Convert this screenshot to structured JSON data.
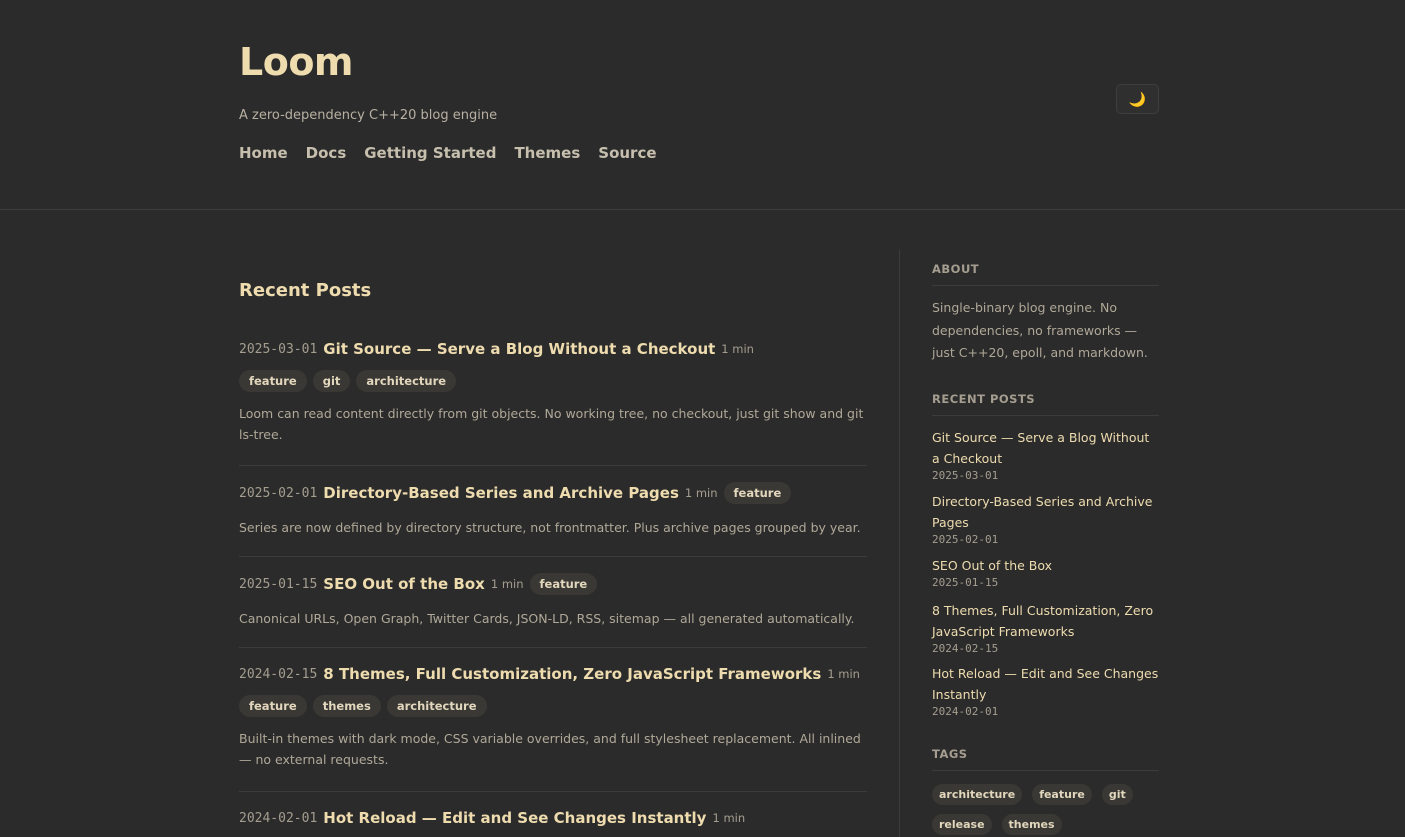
{
  "site": {
    "title": "Loom",
    "tagline": "A zero-dependency C++20 blog engine",
    "theme_icon": "moon-icon"
  },
  "nav": [
    {
      "label": "Home"
    },
    {
      "label": "Docs"
    },
    {
      "label": "Getting Started"
    },
    {
      "label": "Themes"
    },
    {
      "label": "Source"
    }
  ],
  "main": {
    "section_title": "Recent Posts",
    "posts": [
      {
        "date": "2025-03-01",
        "title": "Git Source — Serve a Blog Without a Checkout",
        "read": "1 min",
        "tags": [
          "feature",
          "git",
          "architecture"
        ],
        "excerpt": "Loom can read content directly from git objects. No working tree, no checkout, just git show and git ls-tree."
      },
      {
        "date": "2025-02-01",
        "title": "Directory-Based Series and Archive Pages",
        "read": "1 min",
        "tags": [
          "feature"
        ],
        "excerpt": "Series are now defined by directory structure, not frontmatter. Plus archive pages grouped by year."
      },
      {
        "date": "2025-01-15",
        "title": "SEO Out of the Box",
        "read": "1 min",
        "tags": [
          "feature"
        ],
        "excerpt": "Canonical URLs, Open Graph, Twitter Cards, JSON-LD, RSS, sitemap — all generated automatically."
      },
      {
        "date": "2024-02-15",
        "title": "8 Themes, Full Customization, Zero JavaScript Frameworks",
        "read": "1 min",
        "tags": [
          "feature",
          "themes",
          "architecture"
        ],
        "excerpt": "Built-in themes with dark mode, CSS variable overrides, and full stylesheet replacement. All inlined — no external requests."
      },
      {
        "date": "2024-02-01",
        "title": "Hot Reload — Edit and See Changes Instantly",
        "read": "1 min",
        "tags": [],
        "excerpt": ""
      }
    ]
  },
  "sidebar": {
    "about_heading": "ABOUT",
    "about_text": "Single-binary blog engine. No dependencies, no frameworks — just C++20, epoll, and markdown.",
    "recent_heading": "RECENT POSTS",
    "recent": [
      {
        "title": "Git Source — Serve a Blog Without a Checkout",
        "date": "2025-03-01"
      },
      {
        "title": "Directory-Based Series and Archive Pages",
        "date": "2025-02-01"
      },
      {
        "title": "SEO Out of the Box",
        "date": "2025-01-15"
      },
      {
        "title": "8 Themes, Full Customization, Zero JavaScript Frameworks",
        "date": "2024-02-15"
      },
      {
        "title": "Hot Reload — Edit and See Changes Instantly",
        "date": "2024-02-01"
      }
    ],
    "tags_heading": "TAGS",
    "tags": [
      "architecture",
      "feature",
      "git",
      "release",
      "themes"
    ]
  }
}
